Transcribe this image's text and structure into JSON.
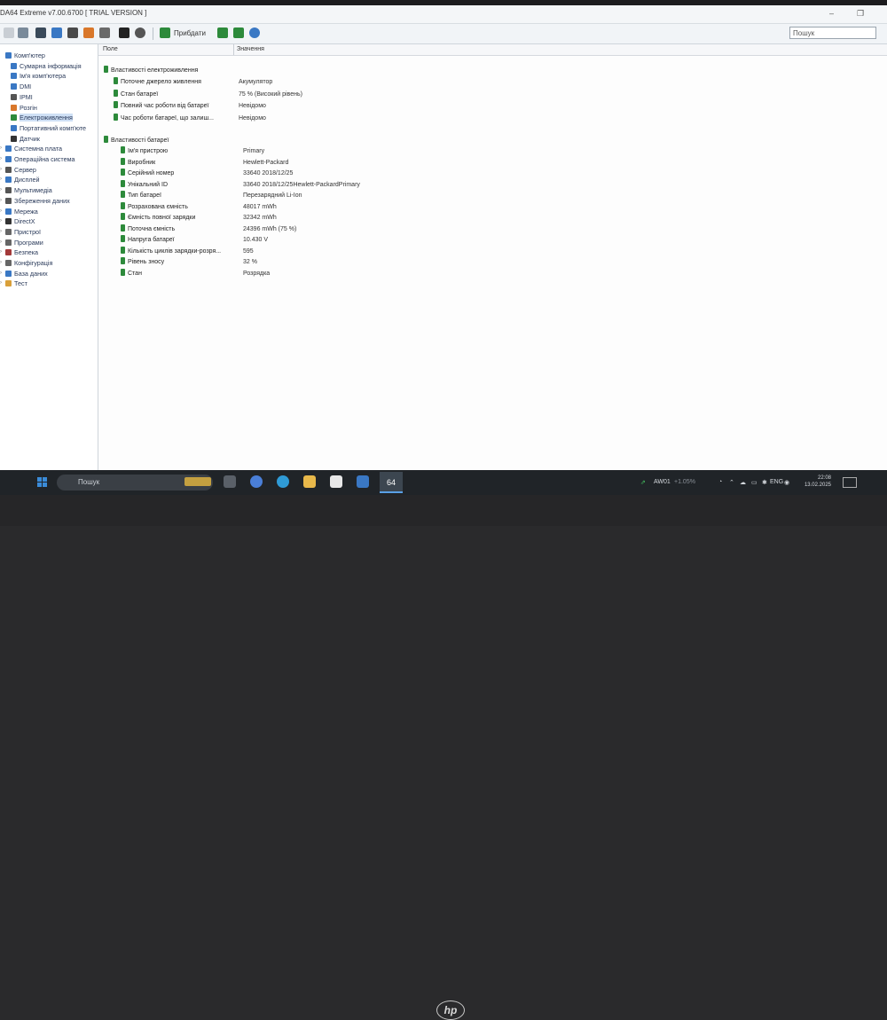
{
  "window": {
    "title": "DA64 Extreme v7.00.6700  [ TRIAL VERSION ]",
    "minimize_glyph": "–",
    "maximize_glyph": "❐"
  },
  "toolbar": {
    "report_label": "Прибдати",
    "search_placeholder": "Пошук",
    "icons": [
      "back-icon",
      "forward-icon",
      "refresh-icon",
      "user-icon",
      "pc-icon",
      "wrench-icon",
      "chart-icon",
      "fps-icon",
      "speedometer-icon",
      "report-icon",
      "download-up-icon",
      "download-down-icon",
      "search-icon"
    ]
  },
  "tree": {
    "items": [
      {
        "label": "Комп'ютер",
        "icon": "computer-icon",
        "color": "#3a78c4"
      },
      {
        "label": "Сумарна інформація",
        "icon": "summary-icon",
        "color": "#3a78c4"
      },
      {
        "label": "Ім'я комп'ютера",
        "icon": "computer-name-icon",
        "color": "#3a78c4"
      },
      {
        "label": "DMI",
        "icon": "dmi-icon",
        "color": "#3a78c4"
      },
      {
        "label": "IPMI",
        "icon": "ipmi-icon",
        "color": "#555555"
      },
      {
        "label": "Розгін",
        "icon": "overclock-icon",
        "color": "#d9772a"
      },
      {
        "label": "Електроживлення",
        "icon": "power-icon",
        "color": "#2d8a3b"
      },
      {
        "label": "Портативний комп'юте",
        "icon": "portable-icon",
        "color": "#3a78c4"
      },
      {
        "label": "Датчик",
        "icon": "sensor-icon",
        "color": "#333333"
      },
      {
        "label": "Системна плата",
        "icon": "motherboard-icon",
        "color": "#3a78c4"
      },
      {
        "label": "Операційна система",
        "icon": "os-icon",
        "color": "#3a78c4"
      },
      {
        "label": "Сервер",
        "icon": "server-icon",
        "color": "#555555"
      },
      {
        "label": "Дисплей",
        "icon": "display-icon",
        "color": "#3a78c4"
      },
      {
        "label": "Мультимедіа",
        "icon": "multimedia-icon",
        "color": "#555555"
      },
      {
        "label": "Збереження даних",
        "icon": "storage-icon",
        "color": "#555555"
      },
      {
        "label": "Мережа",
        "icon": "network-icon",
        "color": "#3a78c4"
      },
      {
        "label": "DirectX",
        "icon": "directx-icon",
        "color": "#333333"
      },
      {
        "label": "Пристрої",
        "icon": "devices-icon",
        "color": "#666666"
      },
      {
        "label": "Програми",
        "icon": "programs-icon",
        "color": "#666666"
      },
      {
        "label": "Безпека",
        "icon": "security-icon",
        "color": "#a33a3a"
      },
      {
        "label": "Конфігурація",
        "icon": "config-icon",
        "color": "#666666"
      },
      {
        "label": "База даних",
        "icon": "database-icon",
        "color": "#3a78c4"
      },
      {
        "label": "Тест",
        "icon": "test-icon",
        "color": "#d9a03a"
      }
    ]
  },
  "table": {
    "header_field": "Поле",
    "header_value": "Значення",
    "section1": "Властивості електроживлення",
    "rows1": [
      {
        "field": "Поточне джерело живлення",
        "value": "Акумулятор"
      },
      {
        "field": "Стан батареї",
        "value": "75 % (Високий рівень)"
      },
      {
        "field": "Повний час роботи від батареї",
        "value": "Невідомо"
      },
      {
        "field": "Час роботи батареї, що залиш...",
        "value": "Невідомо"
      }
    ],
    "section2": "Властивості батареї",
    "rows2": [
      {
        "field": "Ім'я пристрою",
        "value": "Primary"
      },
      {
        "field": "Виробник",
        "value": "Hewlett-Packard"
      },
      {
        "field": "Серійний номер",
        "value": "33640 2018/12/25"
      },
      {
        "field": "Унікальний ID",
        "value": "33640 2018/12/25Hewlett-PackardPrimary"
      },
      {
        "field": "Тип батареї",
        "value": "Перезарядний Li-Ion"
      },
      {
        "field": "Розрахована ємність",
        "value": "48017 mWh"
      },
      {
        "field": "Ємність повної зарядки",
        "value": "32342 mWh"
      },
      {
        "field": "Поточна ємність",
        "value": "24396 mWh  (75 %)"
      },
      {
        "field": "Напруга батареї",
        "value": "10.430 V"
      },
      {
        "field": "Кількість циклів зарядки-розря...",
        "value": "595"
      },
      {
        "field": "Рівень зносу",
        "value": "32 %"
      },
      {
        "field": "Стан",
        "value": "Розрядка"
      }
    ]
  },
  "taskbar": {
    "search_placeholder": "Пошук",
    "aida_label": "64",
    "tray_app": "AW01",
    "tray_app_extra": "+1.05%",
    "language": "ENG",
    "time": "22:08",
    "date": "13.02.2025"
  },
  "colors": {
    "green_item": "#2d8a3b",
    "selection": "#cfe0f5",
    "taskbar": "#202428"
  }
}
